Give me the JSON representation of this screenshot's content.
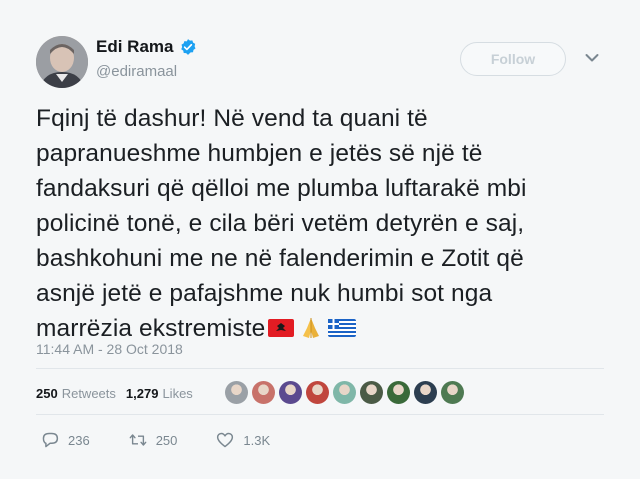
{
  "tweet": {
    "display_name": "Edi Rama",
    "handle": "@ediramaal",
    "follow_label": "Follow",
    "text_lines": [
      "Fqinj të dashur! Në vend ta quani të",
      "papranueshme humbjen e jetës së një të",
      "fandaksuri që qëlloi me plumba luftarakë mbi",
      "policinë tonë, e cila bëri vetëm detyrën e saj,",
      "bashkohuni me ne në falenderimin e Zotit që",
      "asnjë jetë e pafajshme nuk humbi sot nga",
      "marrëzia ekstremiste"
    ],
    "emojis": [
      "albania-flag",
      "folded-hands",
      "greece-flag"
    ],
    "timestamp": "11:44 AM - 28 Oct 2018"
  },
  "stats": {
    "retweets_count": "250",
    "retweets_label": "Retweets",
    "likes_count": "1,279",
    "likes_label": "Likes"
  },
  "likers": [
    "#9aa0a6",
    "#c8726a",
    "#5b4a8f",
    "#c0463d",
    "#7fb7a8",
    "#4b5b46",
    "#3a6a3a",
    "#2c3e50",
    "#4e7a52"
  ],
  "actions": {
    "reply_count": "236",
    "retweet_count": "250",
    "like_count": "1.3K"
  },
  "colors": {
    "verified": "#1da1f2",
    "muted": "#8a949c"
  }
}
